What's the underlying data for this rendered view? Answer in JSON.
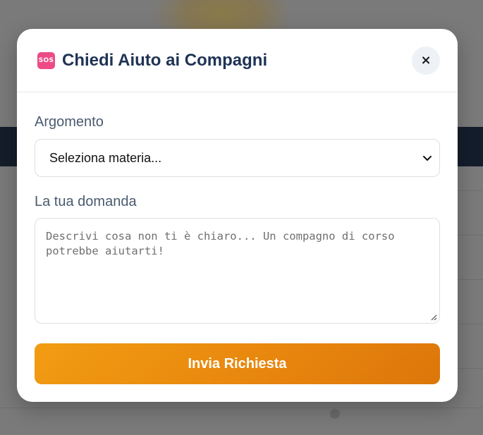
{
  "modal": {
    "icon_label": "SOS",
    "title": "Chiedi Aiuto ai Compagni",
    "close_label": "×",
    "topic": {
      "label": "Argomento",
      "selected": "Seleziona materia..."
    },
    "question": {
      "label": "La tua domanda",
      "placeholder": "Descrivi cosa non ti è chiaro... Un compagno di corso potrebbe aiutarti!"
    },
    "submit_label": "Invia Richiesta"
  },
  "colors": {
    "title": "#1f3355",
    "label": "#4a5a70",
    "sos_badge": "#ee4a86",
    "button_start": "#f29c12",
    "button_end": "#dd760a",
    "overlay": "#7a7a7a"
  },
  "icons": {
    "sos": "sos-icon",
    "close": "close-icon",
    "select": "chevron-down-icon",
    "resize": "resize-handle-icon"
  }
}
